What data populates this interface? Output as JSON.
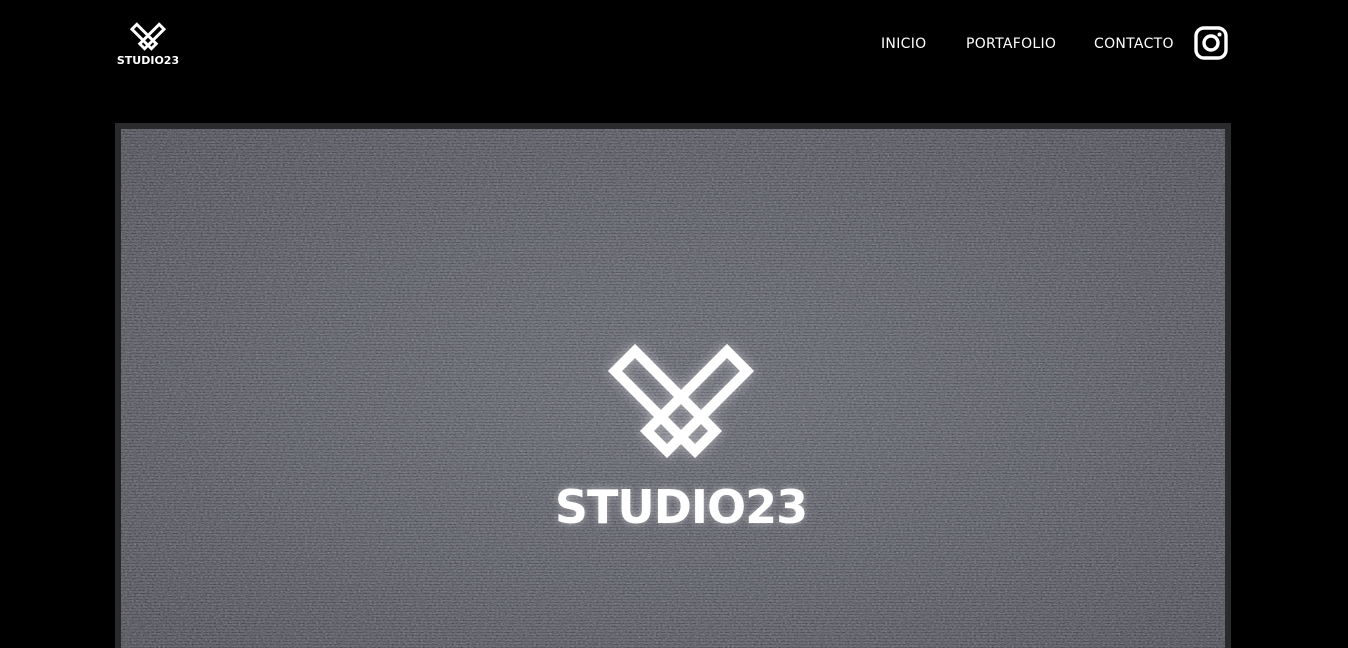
{
  "header": {
    "logo_text": "STUDIO23",
    "nav": [
      {
        "label": "INICIO"
      },
      {
        "label": "PORTAFOLIO"
      },
      {
        "label": "CONTACTO"
      }
    ],
    "social_icon": "instagram-icon"
  },
  "hero": {
    "logo_text": "STUDIO23",
    "background": "tv-static-noise"
  },
  "colors": {
    "background": "#000000",
    "text": "#ffffff",
    "hero_frame": "#2a2a2c"
  }
}
